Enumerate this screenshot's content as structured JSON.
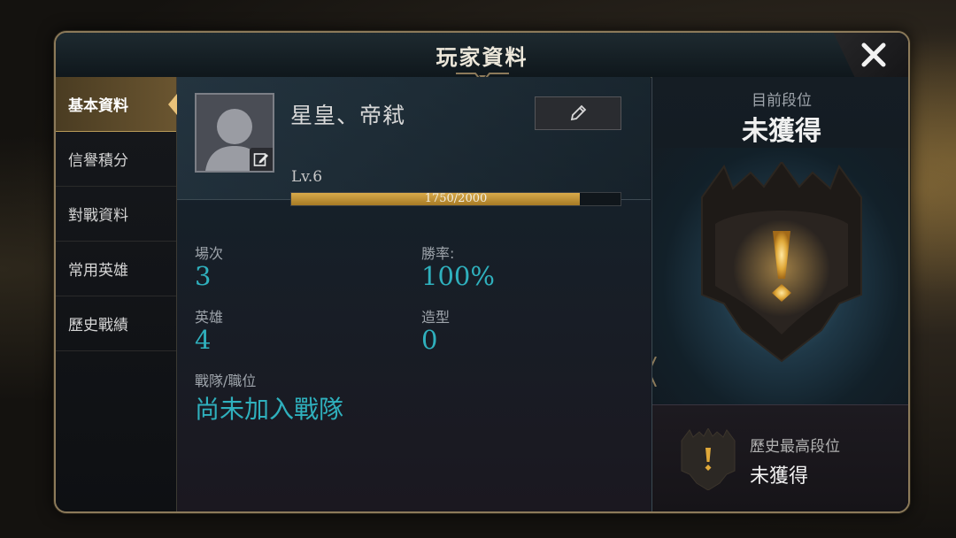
{
  "window": {
    "title": "玩家資料",
    "close_icon": "close-icon"
  },
  "sidebar": {
    "items": [
      {
        "label": "基本資料",
        "active": true
      },
      {
        "label": "信譽積分",
        "active": false
      },
      {
        "label": "對戰資料",
        "active": false
      },
      {
        "label": "常用英雄",
        "active": false
      },
      {
        "label": "歷史戰績",
        "active": false
      }
    ]
  },
  "profile": {
    "player_name": "星皇、帝弒",
    "level": "Lv.6",
    "xp_text": "1750/2000",
    "xp_current": 1750,
    "xp_max": 2000,
    "avatar_icon": "default-avatar-icon",
    "avatar_edit_icon": "edit-icon",
    "rename_icon": "pencil-icon"
  },
  "stats": {
    "matches_label": "場次",
    "matches_value": "3",
    "winrate_label": "勝率:",
    "winrate_value": "100%",
    "heroes_label": "英雄",
    "heroes_value": "4",
    "skins_label": "造型",
    "skins_value": "0",
    "team_label": "戰隊/職位",
    "team_value": "尚未加入戰隊"
  },
  "rank": {
    "current_label": "目前段位",
    "current_value": "未獲得",
    "best_label": "歷史最高段位",
    "best_value": "未獲得",
    "emblem_icon": "rank-unranked-emblem-icon"
  },
  "colors": {
    "accent_gold": "#d9aa4a",
    "stat_cyan": "#2fb0bd",
    "panel_bg": "#141821"
  }
}
